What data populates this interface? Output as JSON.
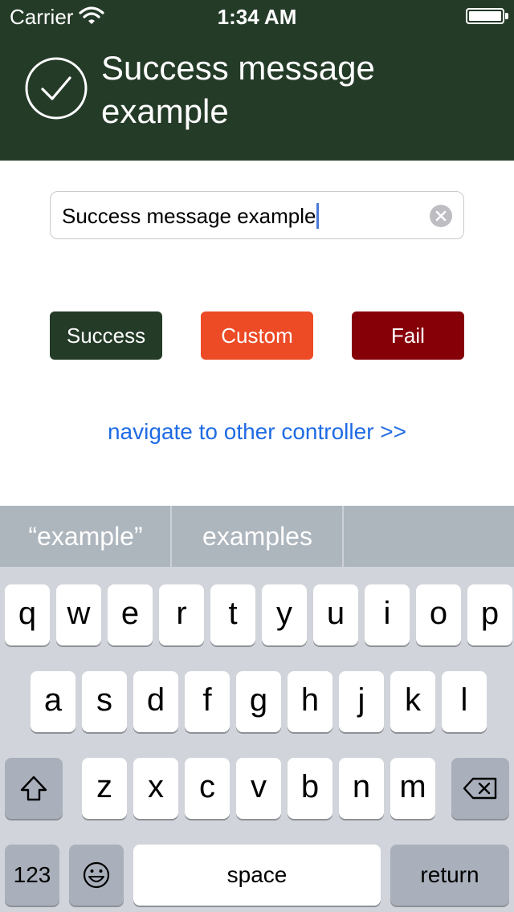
{
  "status_bar": {
    "carrier": "Carrier",
    "time": "1:34 AM",
    "icons": [
      "wifi-icon",
      "battery-icon"
    ]
  },
  "notification": {
    "title": "Success message example",
    "icon": "checkmark-circle-icon",
    "background": "#243b28"
  },
  "text_field": {
    "value": "Success message example",
    "clear_icon": "clear-circle-icon"
  },
  "buttons": {
    "success": {
      "label": "Success",
      "color": "#243b28"
    },
    "custom": {
      "label": "Custom",
      "color": "#ec4b25"
    },
    "fail": {
      "label": "Fail",
      "color": "#860008"
    }
  },
  "nav_link": {
    "label": "navigate to other controller >>",
    "color": "#1f6be4"
  },
  "keyboard": {
    "suggestions": [
      "“example”",
      "examples",
      ""
    ],
    "row1": [
      "q",
      "w",
      "e",
      "r",
      "t",
      "y",
      "u",
      "i",
      "o",
      "p"
    ],
    "row2": [
      "a",
      "s",
      "d",
      "f",
      "g",
      "h",
      "j",
      "k",
      "l"
    ],
    "row3": [
      "z",
      "x",
      "c",
      "v",
      "b",
      "n",
      "m"
    ],
    "shift_icon": "shift-icon",
    "delete_icon": "backspace-icon",
    "numbers_label": "123",
    "emoji_icon": "emoji-icon",
    "space_label": "space",
    "return_label": "return"
  }
}
